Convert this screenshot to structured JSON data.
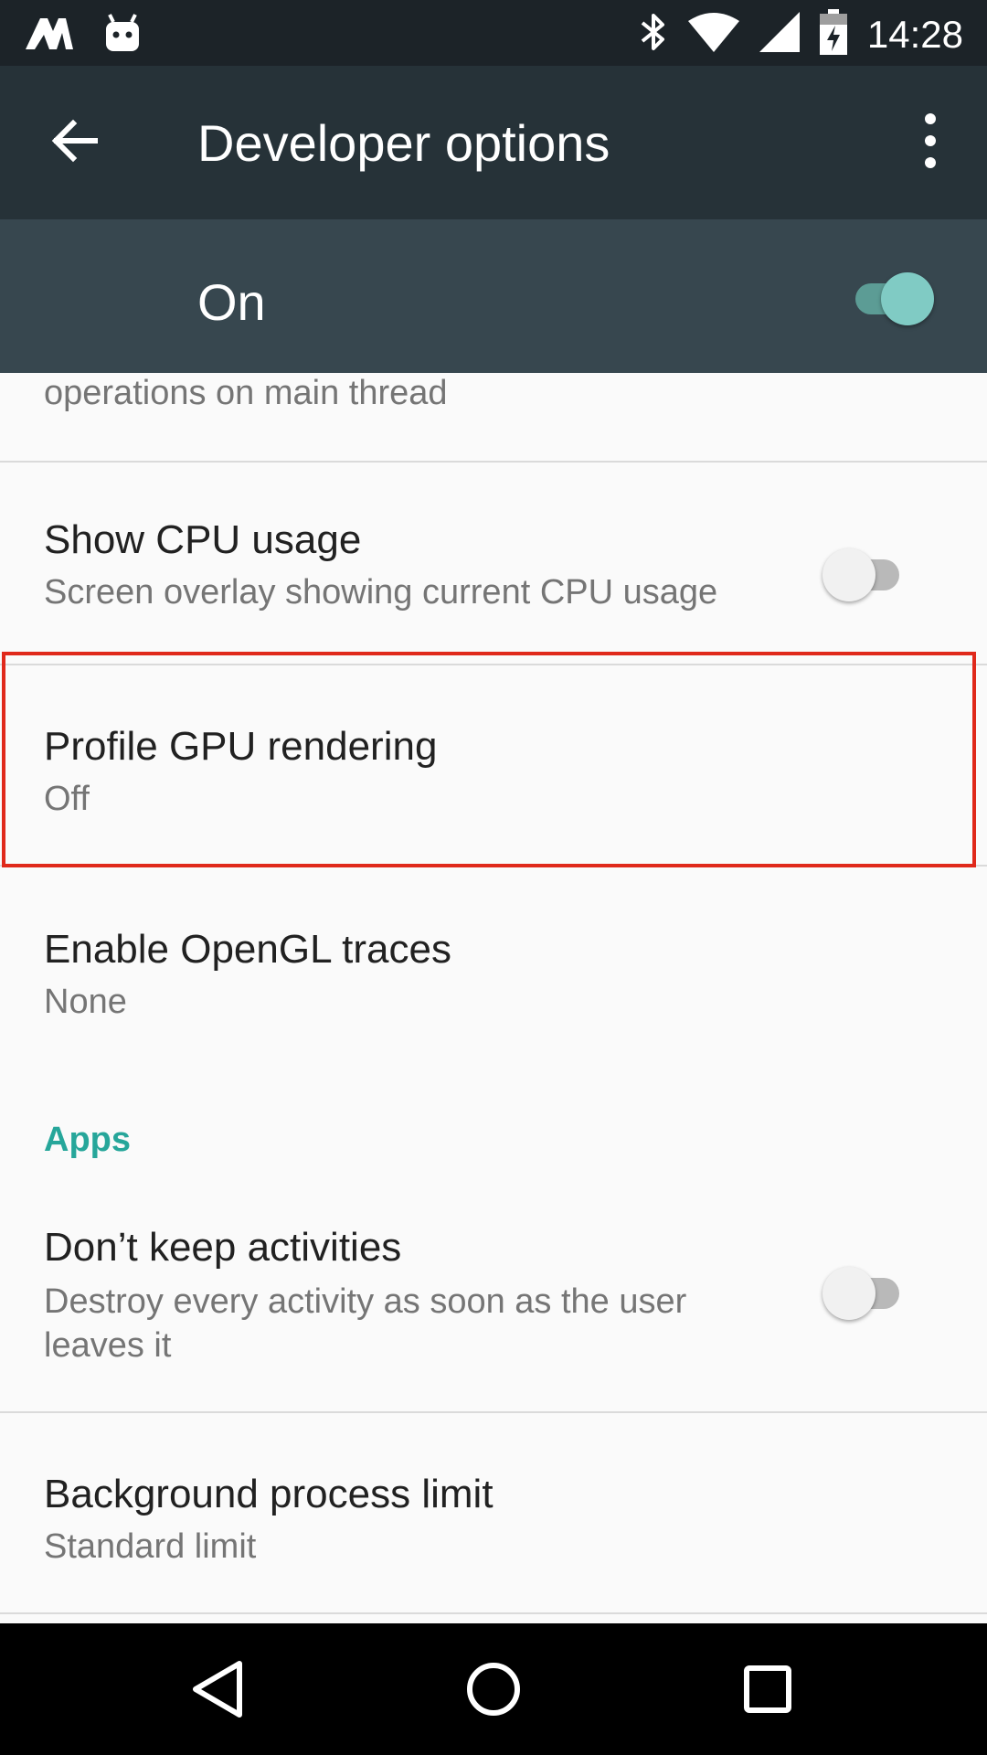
{
  "status_bar": {
    "time": "14:28",
    "icons": [
      "notification-app-icon",
      "android-debug-icon",
      "bluetooth-icon",
      "wifi-icon",
      "cell-signal-icon",
      "battery-charging-icon"
    ]
  },
  "app_bar": {
    "title": "Developer options",
    "back_icon": "arrow-back-icon",
    "menu_icon": "more-vert-icon"
  },
  "master_switch": {
    "label": "On",
    "state": "on"
  },
  "settings": {
    "partial_item": {
      "summary": "operations on main thread"
    },
    "show_cpu_usage": {
      "title": "Show CPU usage",
      "summary": "Screen overlay showing current CPU usage",
      "enabled": false
    },
    "profile_gpu_rendering": {
      "title": "Profile GPU rendering",
      "summary": "Off"
    },
    "enable_opengl_traces": {
      "title": "Enable OpenGL traces",
      "summary": "None"
    },
    "apps_category": "Apps",
    "dont_keep_activities": {
      "title": "Don’t keep activities",
      "summary": "Destroy every activity as soon as the user leaves it",
      "enabled": false
    },
    "background_process_limit": {
      "title": "Background process limit",
      "summary": "Standard limit"
    }
  },
  "nav_bar": {
    "icons": [
      "back-triangle-icon",
      "home-circle-icon",
      "recents-square-icon"
    ]
  },
  "colors": {
    "accent": "#26a69a",
    "app_bar": "#263238",
    "master_bar": "#37474f",
    "highlight_box": "#e0291b"
  }
}
